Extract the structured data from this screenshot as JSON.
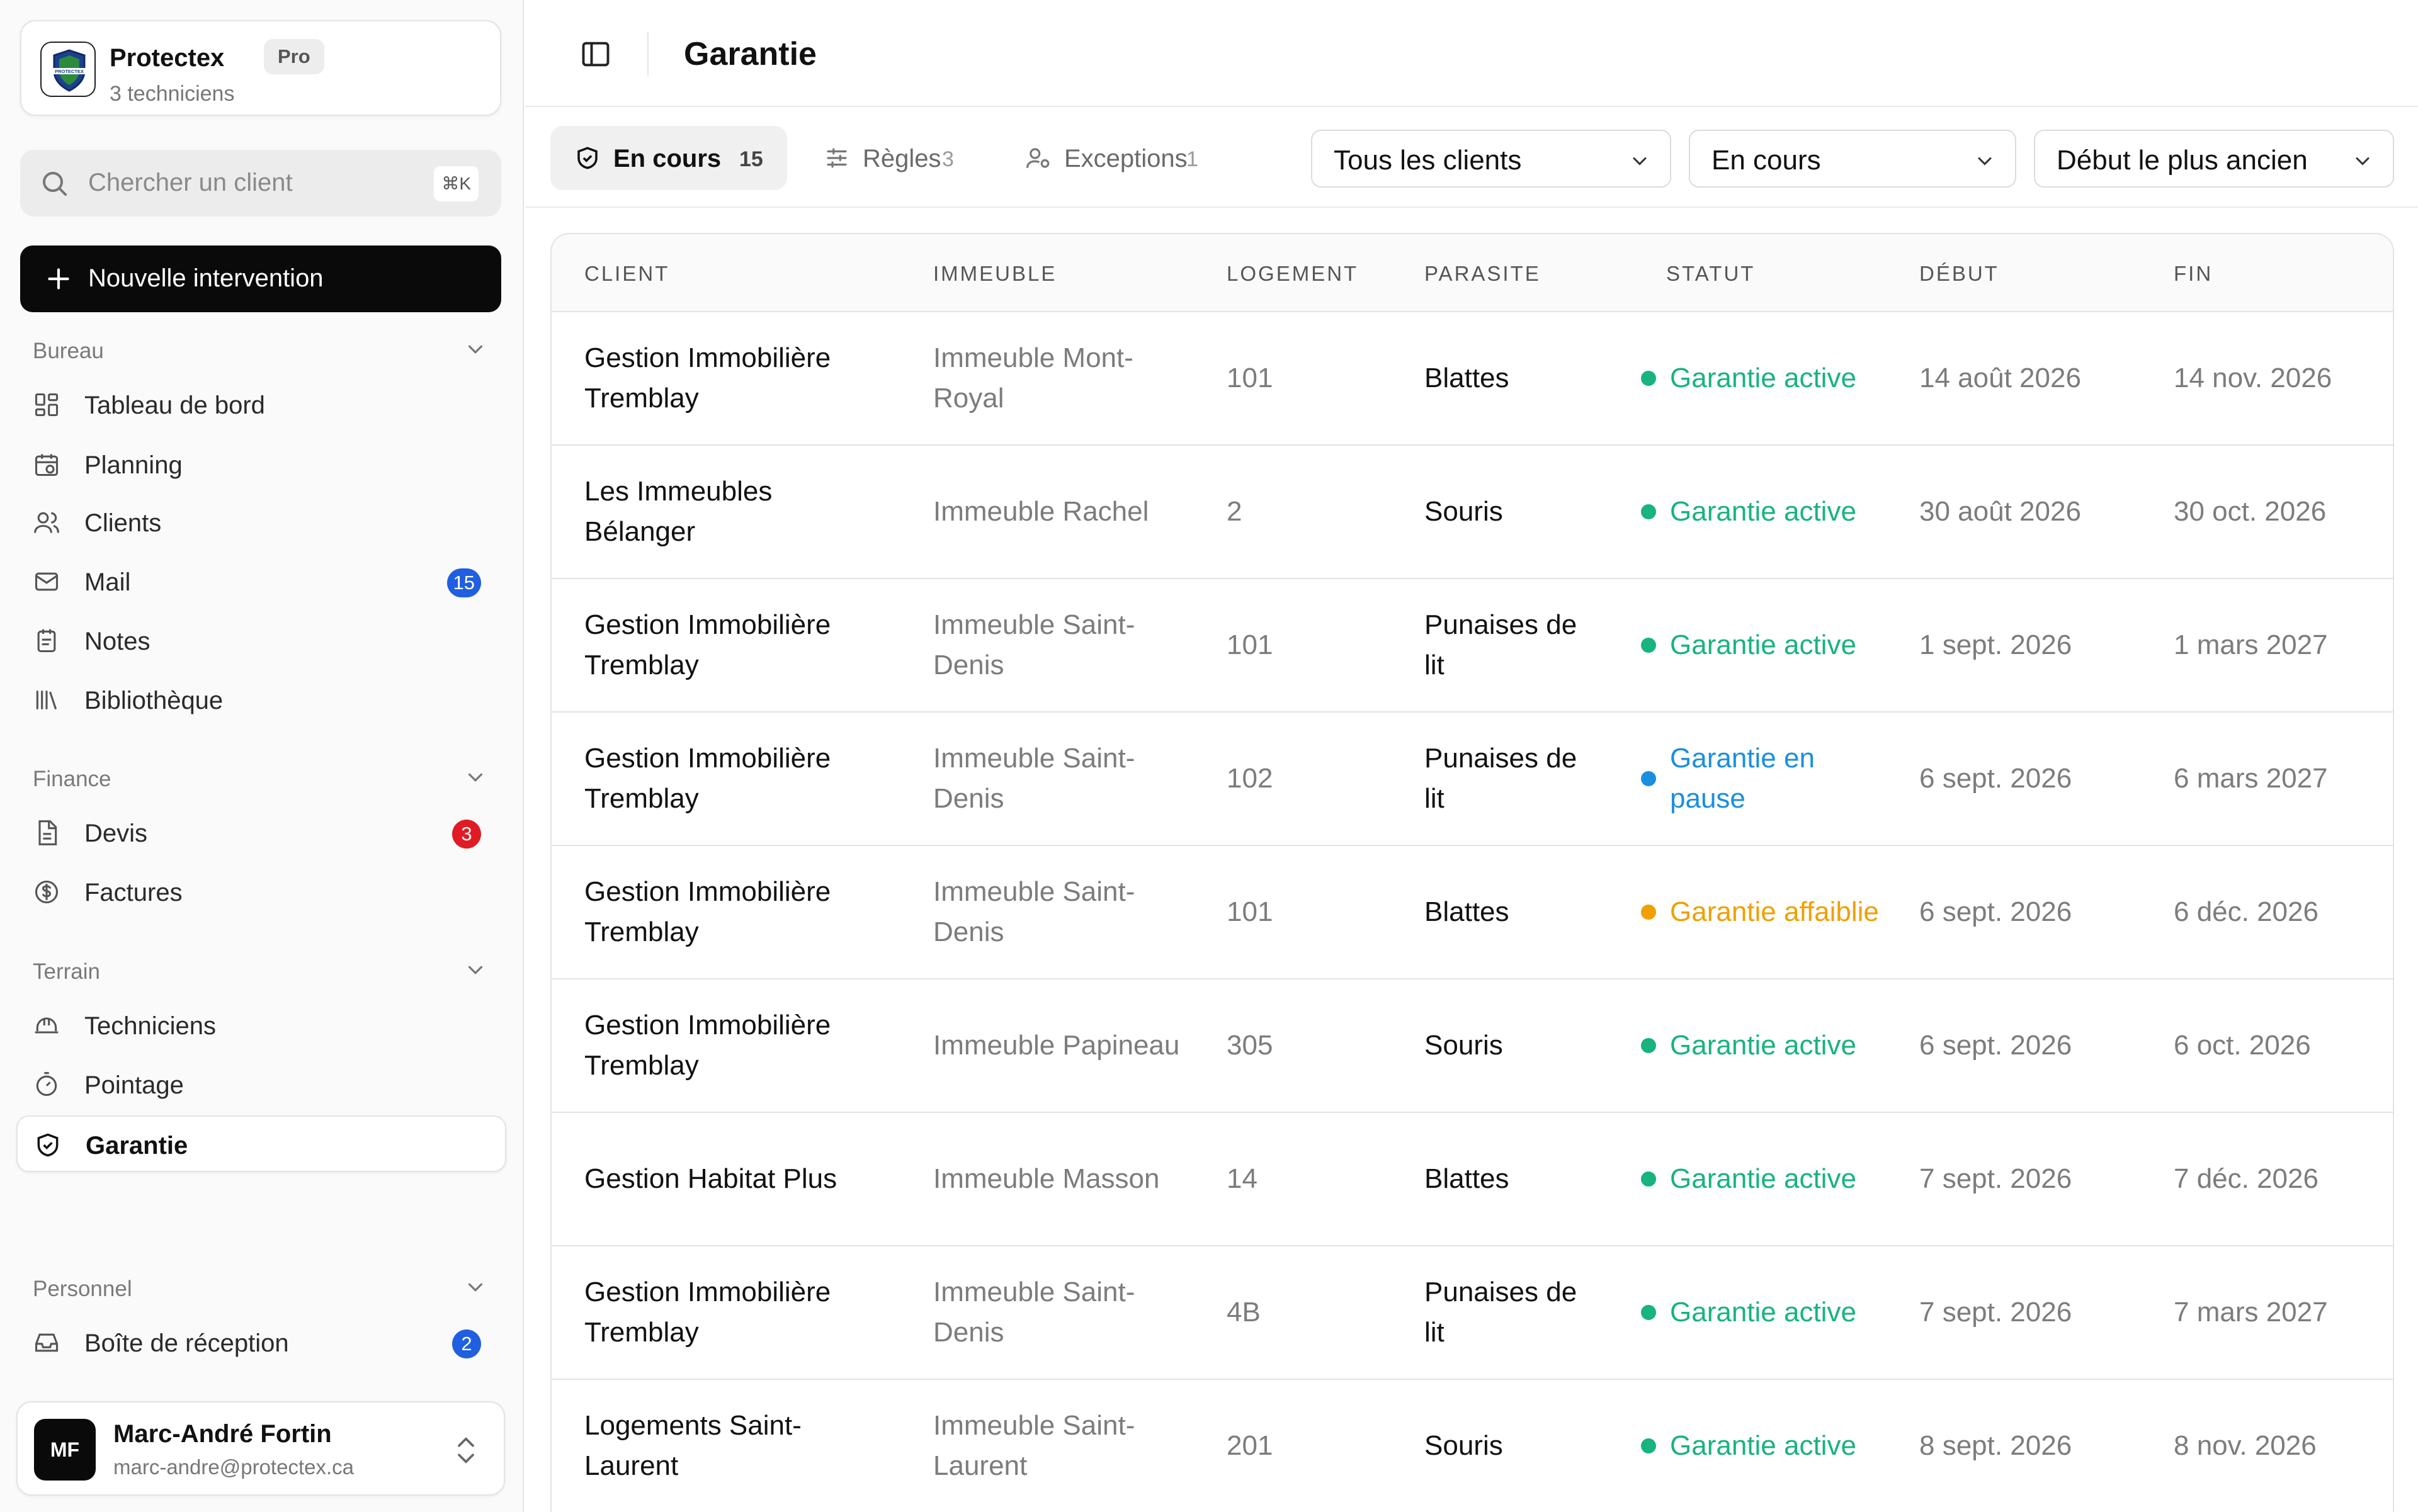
{
  "org": {
    "name": "Protectex",
    "plan": "Pro",
    "subtitle": "3 techniciens",
    "logo_text": "PROTECTEX"
  },
  "search": {
    "placeholder": "Chercher un client",
    "shortcut": "⌘K"
  },
  "new_button": {
    "label": "Nouvelle intervention"
  },
  "sections": {
    "bureau": "Bureau",
    "finance": "Finance",
    "terrain": "Terrain",
    "personnel": "Personnel"
  },
  "nav": {
    "dashboard": "Tableau de bord",
    "planning": "Planning",
    "clients": "Clients",
    "mail": "Mail",
    "mail_count": "15",
    "notes": "Notes",
    "library": "Bibliothèque",
    "quotes": "Devis",
    "quotes_count": "3",
    "invoices": "Factures",
    "technicians": "Techniciens",
    "timeclock": "Pointage",
    "warranty": "Garantie",
    "inbox": "Boîte de réception",
    "inbox_count": "2"
  },
  "user": {
    "initials": "MF",
    "name": "Marc-André Fortin",
    "email": "marc-andre@protectex.ca"
  },
  "page": {
    "title": "Garantie"
  },
  "tabs": [
    {
      "label": "En cours",
      "count": "15",
      "icon": "shield-check-icon"
    },
    {
      "label": "Règles",
      "count": "3",
      "icon": "sliders-icon"
    },
    {
      "label": "Exceptions",
      "count": "1",
      "icon": "user-settings-icon"
    }
  ],
  "filters": {
    "client": "Tous les clients",
    "status": "En cours",
    "sort": "Début le plus ancien"
  },
  "colors": {
    "active": "#17b380",
    "paused": "#1a8fe0",
    "weakened": "#f0a000",
    "badge_blue": "#1f5fe0",
    "badge_red": "#e01b24"
  },
  "table": {
    "columns": [
      "CLIENT",
      "IMMEUBLE",
      "LOGEMENT",
      "PARASITE",
      "STATUT",
      "DÉBUT",
      "FIN"
    ],
    "rows": [
      {
        "client": "Gestion Immobilière Tremblay",
        "immeuble": "Immeuble Mont-Royal",
        "logement": "101",
        "parasite": "Blattes",
        "statut": "Garantie active",
        "status_kind": "active",
        "debut": "14 août 2026",
        "fin": "14 nov. 2026"
      },
      {
        "client": "Les Immeubles Bélanger",
        "immeuble": "Immeuble Rachel",
        "logement": "2",
        "parasite": "Souris",
        "statut": "Garantie active",
        "status_kind": "active",
        "debut": "30 août 2026",
        "fin": "30 oct. 2026"
      },
      {
        "client": "Gestion Immobilière Tremblay",
        "immeuble": "Immeuble Saint-Denis",
        "logement": "101",
        "parasite": "Punaises de lit",
        "statut": "Garantie active",
        "status_kind": "active",
        "debut": "1 sept. 2026",
        "fin": "1 mars 2027"
      },
      {
        "client": "Gestion Immobilière Tremblay",
        "immeuble": "Immeuble Saint-Denis",
        "logement": "102",
        "parasite": "Punaises de lit",
        "statut": "Garantie en pause",
        "status_kind": "paused",
        "debut": "6 sept. 2026",
        "fin": "6 mars 2027"
      },
      {
        "client": "Gestion Immobilière Tremblay",
        "immeuble": "Immeuble Saint-Denis",
        "logement": "101",
        "parasite": "Blattes",
        "statut": "Garantie affaiblie",
        "status_kind": "weakened",
        "debut": "6 sept. 2026",
        "fin": "6 déc. 2026"
      },
      {
        "client": "Gestion Immobilière Tremblay",
        "immeuble": "Immeuble Papineau",
        "logement": "305",
        "parasite": "Souris",
        "statut": "Garantie active",
        "status_kind": "active",
        "debut": "6 sept. 2026",
        "fin": "6 oct. 2026"
      },
      {
        "client": "Gestion Habitat Plus",
        "immeuble": "Immeuble Masson",
        "logement": "14",
        "parasite": "Blattes",
        "statut": "Garantie active",
        "status_kind": "active",
        "debut": "7 sept. 2026",
        "fin": "7 déc. 2026"
      },
      {
        "client": "Gestion Immobilière Tremblay",
        "immeuble": "Immeuble Saint-Denis",
        "logement": "4B",
        "parasite": "Punaises de lit",
        "statut": "Garantie active",
        "status_kind": "active",
        "debut": "7 sept. 2026",
        "fin": "7 mars 2027"
      },
      {
        "client": "Logements Saint-Laurent",
        "immeuble": "Immeuble Saint-Laurent",
        "logement": "201",
        "parasite": "Souris",
        "statut": "Garantie active",
        "status_kind": "active",
        "debut": "8 sept. 2026",
        "fin": "8 nov. 2026"
      }
    ]
  }
}
